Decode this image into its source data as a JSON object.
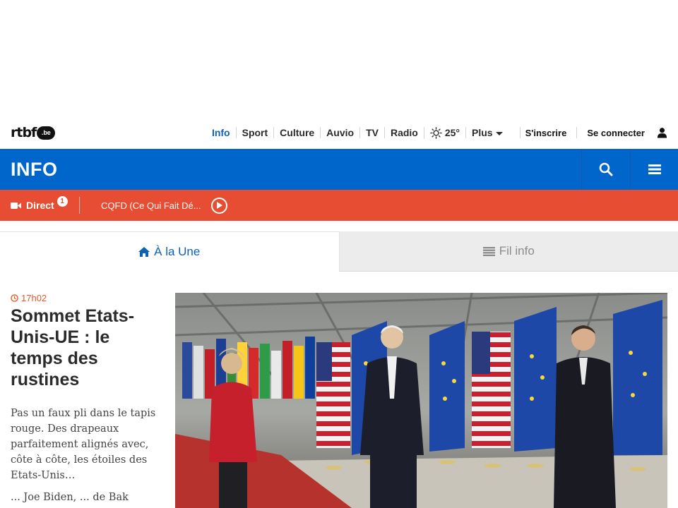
{
  "topnav": {
    "logo_text": "rtbf",
    "logo_badge": ".be",
    "links": [
      {
        "label": "Info",
        "active": true
      },
      {
        "label": "Sport",
        "active": false
      },
      {
        "label": "Culture",
        "active": false
      },
      {
        "label": "Auvio",
        "active": false
      },
      {
        "label": "TV",
        "active": false
      },
      {
        "label": "Radio",
        "active": false
      }
    ],
    "weather": "25°",
    "more_label": "Plus",
    "signup_label": "S'inscrire",
    "login_label": "Se connecter",
    "icons": {
      "weather": "sun-icon",
      "user": "user-icon",
      "more": "chevron-down-icon"
    }
  },
  "section_bar": {
    "title": "INFO",
    "icons": {
      "search": "search-icon",
      "menu": "hamburger-menu-icon"
    },
    "color": "#0066cc"
  },
  "live_bar": {
    "direct_label": "Direct",
    "direct_count": "1",
    "program_title": "CQFD (Ce Qui Fait Dé...",
    "color": "#e64d32",
    "icons": {
      "camera": "video-camera-icon",
      "play": "play-icon"
    }
  },
  "tabs": [
    {
      "label": "À la Une",
      "icon": "home-icon",
      "active": true
    },
    {
      "label": "Fil info",
      "icon": "list-icon",
      "active": false
    }
  ],
  "article": {
    "time": "17h02",
    "headline": "Sommet Etats-Unis-UE : le temps des rustines",
    "lede": "Pas un faux pli dans le tapis rouge. Des drapeaux parfaitement alignés avec, côte à côte, les étoiles des Etats-Unis…",
    "lede_more": "... Joe Biden, ... de Bak",
    "icons": {
      "time": "clock-icon"
    }
  },
  "colors": {
    "accent_blue": "#0066cc",
    "link_blue": "#0d62b8",
    "live_red": "#e64d32",
    "time_orange": "#de5b28"
  }
}
